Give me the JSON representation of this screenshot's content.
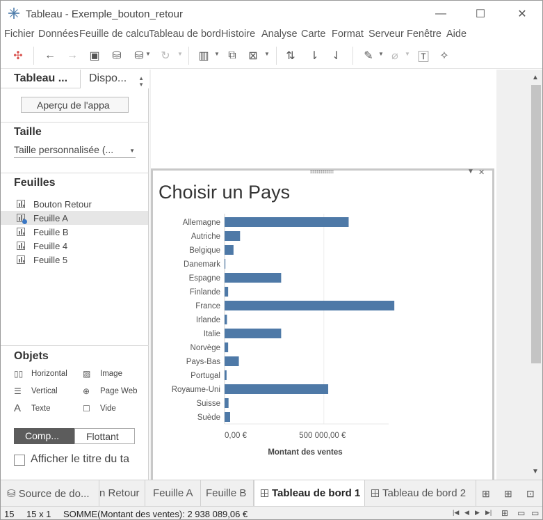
{
  "window": {
    "title": "Tableau - Exemple_bouton_retour"
  },
  "menu": [
    "Fichier",
    "Données",
    "Feuille de calcul",
    "Tableau de bord",
    "Histoire",
    "Analyse",
    "Carte",
    "Format",
    "Serveur",
    "Fenêtre",
    "Aide"
  ],
  "left_panel": {
    "tab_dashboard": "Tableau ...",
    "tab_layout": "Dispo...",
    "preview_button": "Aperçu de l'appa",
    "size_heading": "Taille",
    "size_value": "Taille personnalisée (...",
    "sheets_heading": "Feuilles",
    "sheets": [
      "Bouton Retour",
      "Feuille A",
      "Feuille B",
      "Feuille 4",
      "Feuille 5"
    ],
    "objects_heading": "Objets",
    "objects": {
      "horizontal": "Horizontal",
      "image": "Image",
      "vertical": "Vertical",
      "webpage": "Page Web",
      "text": "Texte",
      "blank": "Vide"
    },
    "tiled": "Comp...",
    "floating": "Flottant",
    "show_title": "Afficher le titre du ta"
  },
  "chart_data": {
    "type": "bar",
    "orientation": "horizontal",
    "title": "Choisir un Pays",
    "xlabel": "Montant des ventes",
    "ylabel": "",
    "categories": [
      "Allemagne",
      "Autriche",
      "Belgique",
      "Danemark",
      "Espagne",
      "Finlande",
      "France",
      "Irlande",
      "Italie",
      "Norvège",
      "Pays-Bas",
      "Portugal",
      "Royaume-Uni",
      "Suisse",
      "Suède"
    ],
    "values": [
      625000,
      78000,
      45000,
      4000,
      285000,
      18000,
      855000,
      12000,
      285000,
      18000,
      72000,
      10000,
      522000,
      20000,
      28000
    ],
    "xlim": [
      0,
      900000
    ],
    "x_ticks": [
      0,
      500000
    ],
    "x_tick_labels": [
      "0,00 €",
      "500 000,00 €"
    ],
    "color": "#4e79a7",
    "grid": true,
    "legend": "none"
  },
  "bottom_tabs": [
    "Source de do...",
    "n Retour",
    "Feuille A",
    "Feuille B",
    "Tableau de bord 1",
    "Tableau de bord 2"
  ],
  "status": {
    "marks": "15",
    "dims": "15 x 1",
    "sum": "SOMME(Montant des ventes): 2 938 089,06 €"
  }
}
